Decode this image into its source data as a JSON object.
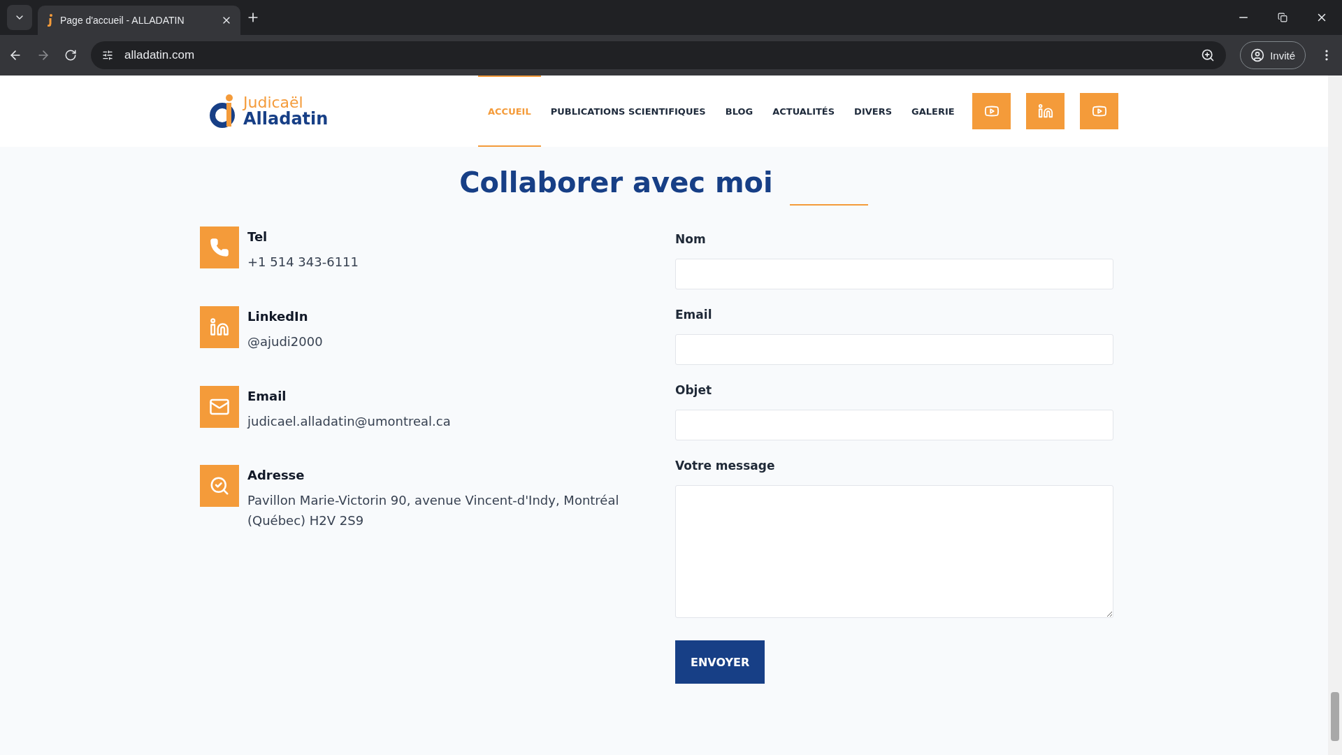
{
  "browser": {
    "tab_title": "Page d'accueil - ALLADATIN",
    "url": "alladatin.com",
    "profile": "Invité"
  },
  "header": {
    "logo": {
      "first": "Judicaël",
      "last": "Alladatin"
    },
    "nav": [
      {
        "label": "ACCUEIL",
        "selected": true
      },
      {
        "label": "PUBLICATIONS SCIENTIFIQUES",
        "selected": false
      },
      {
        "label": "BLOG",
        "selected": false
      },
      {
        "label": "ACTUALITÉS",
        "selected": false
      },
      {
        "label": "DIVERS",
        "selected": false
      },
      {
        "label": "GALERIE",
        "selected": false
      }
    ],
    "social": [
      {
        "kind": "youtube"
      },
      {
        "kind": "linkedin"
      },
      {
        "kind": "youtube"
      }
    ]
  },
  "title": "Collaborer avec moi",
  "contacts": [
    {
      "kind": "phone",
      "label": "Tel",
      "value": "+1 514 343-6111"
    },
    {
      "kind": "linkedin",
      "label": "LinkedIn",
      "value": "@ajudi2000"
    },
    {
      "kind": "email",
      "label": "Email",
      "value": "judicael.alladatin@umontreal.ca"
    },
    {
      "kind": "address",
      "label": "Adresse",
      "value": "Pavillon Marie-Victorin 90, avenue Vincent-d'Indy, Montréal (Québec) H2V 2S9"
    }
  ],
  "form": {
    "fields": [
      {
        "label": "Nom",
        "kind": "text"
      },
      {
        "label": "Email",
        "kind": "text"
      },
      {
        "label": "Objet",
        "kind": "text"
      },
      {
        "label": "Votre message",
        "kind": "textarea"
      }
    ],
    "submit": "ENVOYER"
  }
}
